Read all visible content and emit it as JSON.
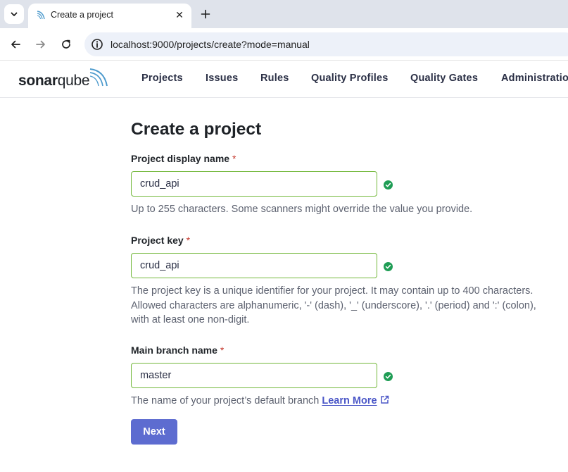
{
  "browser": {
    "tab_title": "Create a project",
    "tab_close": "✕",
    "url": "localhost:9000/projects/create?mode=manual"
  },
  "sonarqube": {
    "logo": {
      "bold": "sonar",
      "light": "qube"
    },
    "nav": [
      "Projects",
      "Issues",
      "Rules",
      "Quality Profiles",
      "Quality Gates",
      "Administration"
    ]
  },
  "form": {
    "title": "Create a project",
    "required_marker": "*",
    "display_name": {
      "label": "Project display name",
      "value": "crud_api",
      "help": "Up to 255 characters. Some scanners might override the value you provide."
    },
    "project_key": {
      "label": "Project key",
      "value": "crud_api",
      "help": [
        "The project key is a unique identifier for your project. It may contain up to 400 characters.",
        "Allowed characters are alphanumeric, '-' (dash), '_' (underscore), '.' (period) and ':' (colon),",
        "with at least one non-digit."
      ]
    },
    "main_branch": {
      "label": "Main branch name",
      "value": "master",
      "help": "The name of your project’s default branch",
      "learn_more": "Learn More"
    },
    "next_button": "Next"
  },
  "colors": {
    "valid_border": "#73b83b",
    "valid_check": "#1f9d55",
    "primary_button": "#5d6cd0",
    "link": "#4a56c7",
    "required": "#c4372b"
  },
  "icons": [
    "tab-menu-chevron-icon",
    "sonarqube-favicon-icon",
    "close-icon",
    "plus-icon",
    "back-arrow-icon",
    "forward-arrow-icon",
    "reload-icon",
    "site-info-icon",
    "check-circle-icon",
    "external-link-icon"
  ]
}
